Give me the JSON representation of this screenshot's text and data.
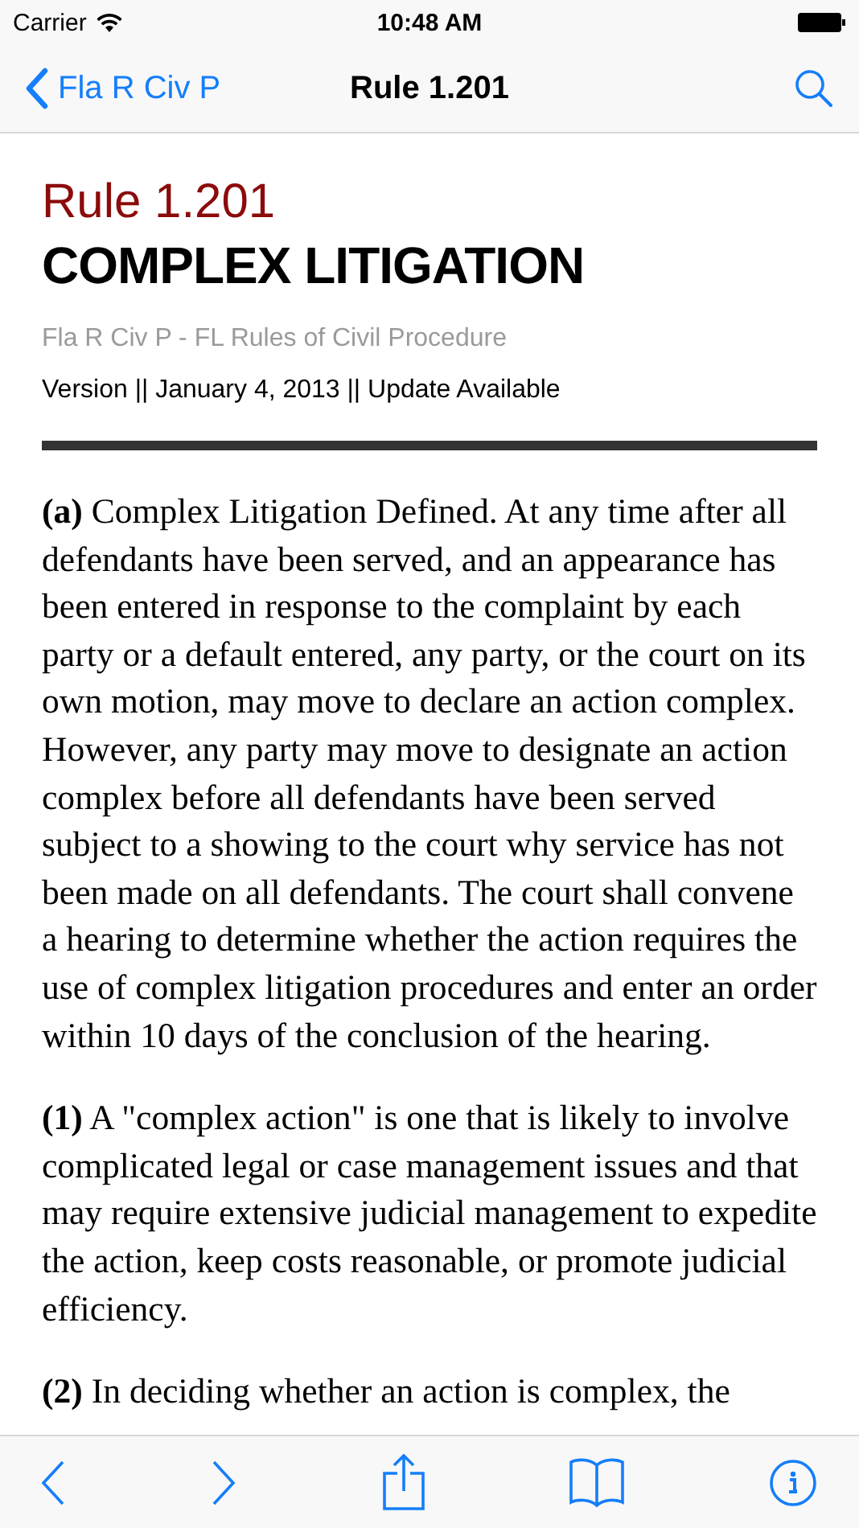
{
  "status_bar": {
    "carrier": "Carrier",
    "time": "10:48 AM"
  },
  "nav_bar": {
    "back_label": "Fla R Civ P",
    "title": "Rule 1.201"
  },
  "document": {
    "rule_number": "Rule 1.201",
    "title": "COMPLEX LITIGATION",
    "source": "Fla R Civ P - FL Rules of Civil Procedure",
    "version_line": "Version || January 4, 2013 || Update Available",
    "paragraphs": [
      "**(a)** Complex Litigation Defined. At any time after all defendants have been served, and an appearance has been entered in response to the complaint by each party or a default entered, any party, or the court on its own motion, may move to declare an action complex. However, any party may move to designate an action complex before all defendants have been served subject to a showing to the court why service has not been made on all defendants. The court shall convene a hearing to determine whether the action requires the use of complex litigation procedures and enter an order within 10 days of the conclusion of the hearing.",
      "**(1)** A \"complex action\" is one that is likely to involve complicated legal or case management issues and that may require extensive judicial management to expedite the action, keep costs reasonable, or promote judicial efficiency.",
      "**(2)** In deciding whether an action is complex, the"
    ]
  }
}
